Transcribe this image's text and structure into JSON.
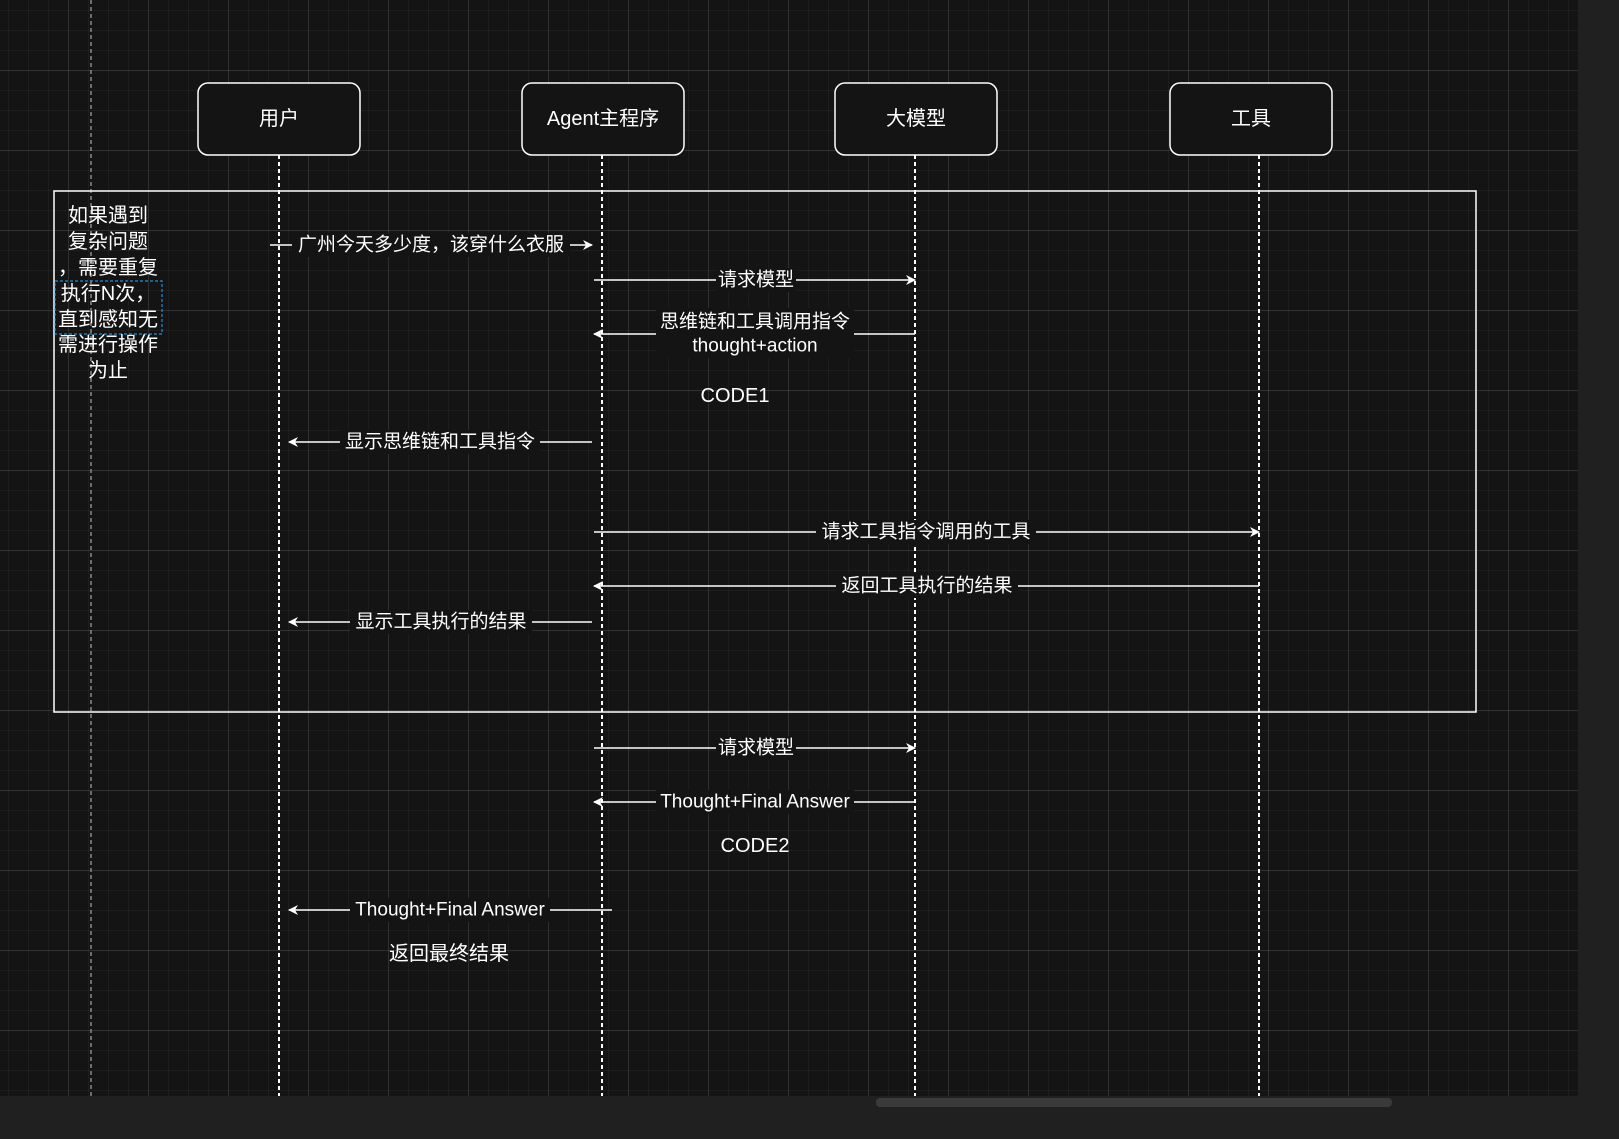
{
  "participants": {
    "user": "用户",
    "agent": "Agent主程序",
    "model": "大模型",
    "tool": "工具"
  },
  "loop_note": "如果遇到复杂问题，需要重复执行N次，直到感知无需进行操作为止",
  "messages": {
    "m1": "广州今天多少度，该穿什么衣服",
    "m2": "请求模型",
    "m3a": "思维链和工具调用指令",
    "m3b": "thought+action",
    "code1": "CODE1",
    "m4": "显示思维链和工具指令",
    "m5": "请求工具指令调用的工具",
    "m6": "返回工具执行的结果",
    "m7": "显示工具执行的结果",
    "m8": "请求模型",
    "m9": "Thought+Final Answer",
    "code2": "CODE2",
    "m10": "Thought+Final Answer",
    "final_note": "返回最终结果"
  },
  "colors": {
    "background": "#141414",
    "line": "#ffffff",
    "box_fill": "#141414",
    "note_border": "#1f8fd6"
  }
}
